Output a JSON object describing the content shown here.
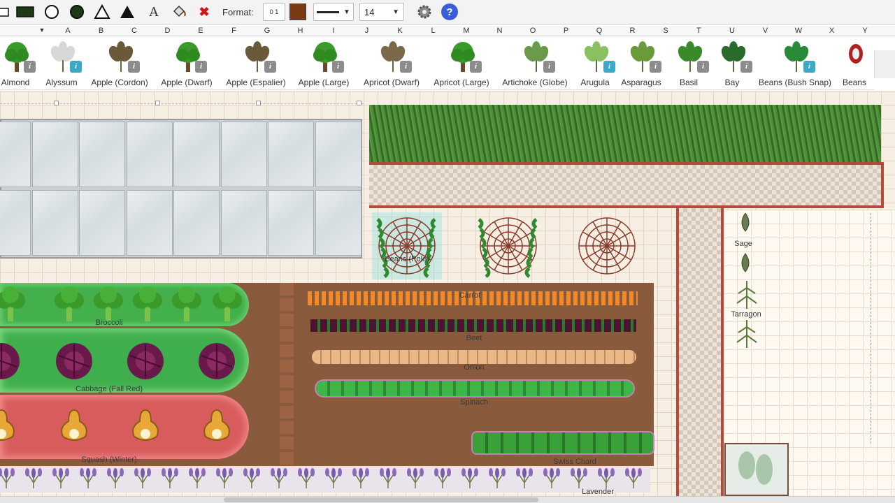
{
  "toolbar": {
    "format_label": "Format:",
    "font_size": "14",
    "dropdown_arrow": "▼",
    "scale_glyph": "0  1",
    "text_tool_glyph": "A",
    "delete_glyph": "✖",
    "help_glyph": "?",
    "fill_color": "#7a3a12",
    "icons": [
      "rectangle-icon",
      "filled-rectangle-icon",
      "circle-icon",
      "filled-circle-icon",
      "triangle-icon",
      "filled-triangle-icon",
      "text-icon",
      "paint-bucket-icon",
      "delete-icon",
      "ruler-scale-icon",
      "color-swatch-icon",
      "line-style-icon",
      "font-size-select",
      "settings-gear-icon",
      "help-icon"
    ]
  },
  "ruler": {
    "columns": [
      "A",
      "B",
      "C",
      "D",
      "E",
      "F",
      "G",
      "H",
      "I",
      "J",
      "K",
      "L",
      "M",
      "N",
      "O",
      "P",
      "Q",
      "R",
      "S",
      "T",
      "U",
      "V",
      "W",
      "X",
      "Y"
    ],
    "corner_arrow": "▼"
  },
  "library": {
    "info_glyph": "i",
    "plants": [
      {
        "name": "Almond",
        "icon": "tree-icon",
        "info_style": "gray"
      },
      {
        "name": "Alyssum",
        "icon": "flower-cluster-icon",
        "info_style": "teal"
      },
      {
        "name": "Apple (Cordon)",
        "icon": "cordon-apple-icon",
        "info_style": "gray"
      },
      {
        "name": "Apple (Dwarf)",
        "icon": "tree-icon",
        "info_style": "gray"
      },
      {
        "name": "Apple (Espalier)",
        "icon": "espalier-icon",
        "info_style": "gray"
      },
      {
        "name": "Apple (Large)",
        "icon": "tree-icon",
        "info_style": "gray"
      },
      {
        "name": "Apricot (Dwarf)",
        "icon": "bare-tree-icon",
        "info_style": "gray"
      },
      {
        "name": "Apricot (Large)",
        "icon": "tree-icon",
        "info_style": "gray"
      },
      {
        "name": "Artichoke (Globe)",
        "icon": "artichoke-icon",
        "info_style": "gray"
      },
      {
        "name": "Arugula",
        "icon": "arugula-icon",
        "info_style": "teal"
      },
      {
        "name": "Asparagus",
        "icon": "asparagus-icon",
        "info_style": "gray"
      },
      {
        "name": "Basil",
        "icon": "basil-icon",
        "info_style": "gray"
      },
      {
        "name": "Bay",
        "icon": "bay-leaf-icon",
        "info_style": "gray"
      },
      {
        "name": "Beans (Bush Snap)",
        "icon": "bean-pod-icon",
        "info_style": "teal"
      },
      {
        "name": "Beans",
        "icon": "bean-icon",
        "info_style": "none"
      }
    ]
  },
  "garden": {
    "labels": {
      "beans_pole": "Beans (Pole)",
      "sage": "Sage",
      "tarragon": "Tarragon",
      "broccoli": "Broccoli",
      "cabbage": "Cabbage (Fall Red)",
      "squash": "Squash (Winter)",
      "carrot": "Carrot",
      "beet": "Beet",
      "onion": "Onion",
      "spinach": "Spinach",
      "swiss_chard": "Swiss Chard",
      "lavender": "Lavender"
    },
    "colors": {
      "soil": "#8a5a3c",
      "bed_green": "#43b04c",
      "bed_red": "#d85c5c",
      "path_border": "#b34a3a",
      "lawn": "#3f7c2c"
    }
  }
}
